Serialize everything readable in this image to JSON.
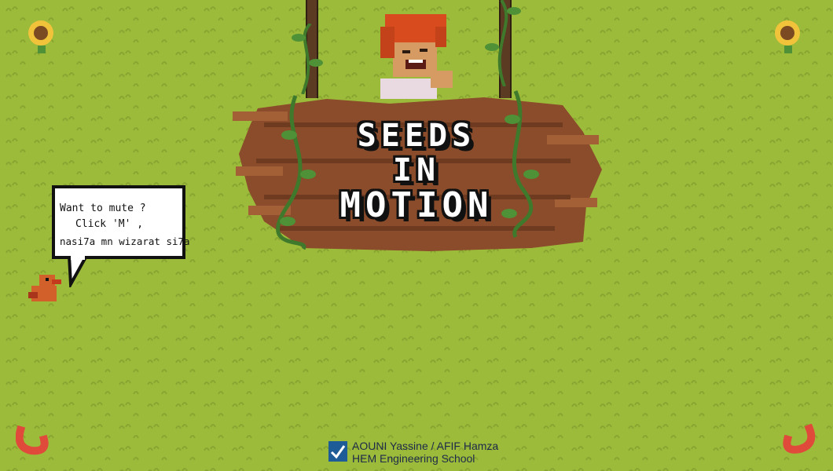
{
  "title": {
    "line1": "SEEDS",
    "line2": "IN",
    "line3": "MOTION"
  },
  "speech_bubble": {
    "line1": "Want to mute ?",
    "line2": "Click 'M' ,",
    "line3": "nasi7a mn wizarat si7a"
  },
  "credits": {
    "authors": "AOUNI Yassine / AFIF Hamza",
    "school": "HEM Engineering School"
  },
  "colors": {
    "grass": "#9dbb3a",
    "sign_wood": "#8a4c2a",
    "vine": "#3f7a2c",
    "hair": "#d84b1f"
  },
  "icons": [
    "sunflower-icon",
    "bird-icon",
    "worm-icon",
    "school-logo-icon"
  ]
}
